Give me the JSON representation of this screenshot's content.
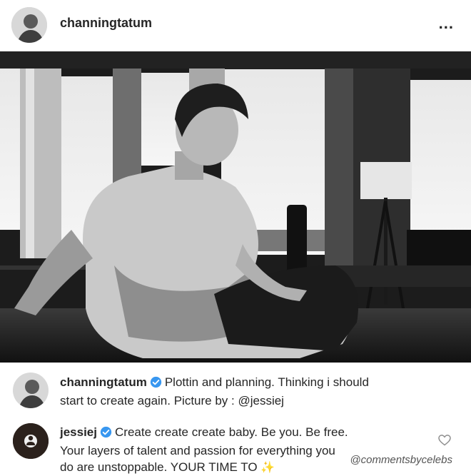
{
  "post": {
    "username": "channingtatum",
    "more_icon": "more-horizontal-icon",
    "more_label": "..."
  },
  "caption": {
    "username": "channingtatum",
    "line1": "Plottin and planning. Thinking i should",
    "line2": "start to create again.  Picture by : @jessiej"
  },
  "comment": {
    "username": "jessiej",
    "line1": "Create create create baby. Be you. Be free.",
    "line2": "Your layers of talent and passion for everything you",
    "line3": "do are unstoppable. YOUR TIME TO",
    "emoji": "✨",
    "heart_icon": "heart-outline-icon"
  },
  "watermark": "@commentsbycelebs",
  "colors": {
    "verified": "#3897f0",
    "text": "#262626"
  }
}
